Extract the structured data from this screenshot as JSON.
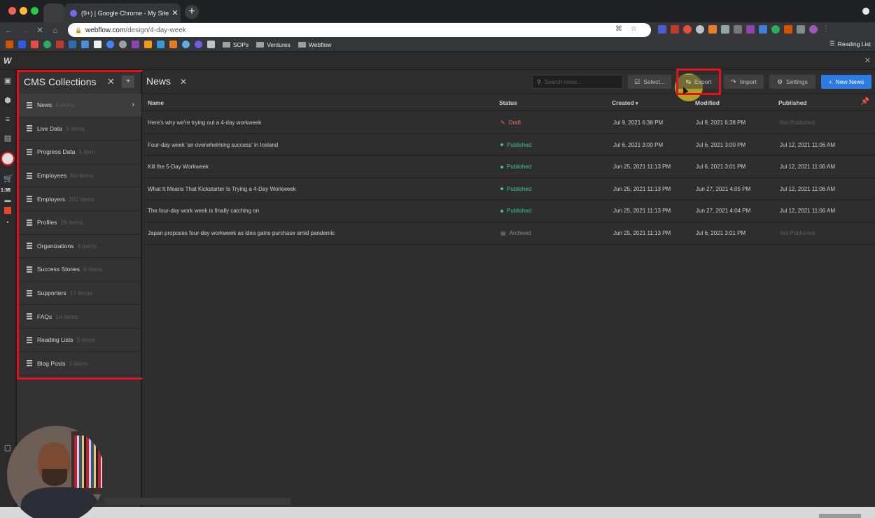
{
  "browser": {
    "tab_title": "(9+) | Google Chrome - My Site",
    "tab_close": "✕",
    "new_tab": "+",
    "url_host": "webflow.com",
    "url_path": "/design/4-day-week",
    "bookmark_folders": [
      "SOPs",
      "Ventures",
      "Webflow"
    ],
    "reading_list": "Reading List"
  },
  "webflow": {
    "logo": "W",
    "timer": "1:36"
  },
  "cms": {
    "title": "CMS Collections",
    "close": "✕",
    "add_icon": "+",
    "collections": [
      {
        "name": "News",
        "count": "6 items"
      },
      {
        "name": "Live Data",
        "count": "3 items"
      },
      {
        "name": "Progress Data",
        "count": "1 item"
      },
      {
        "name": "Employees",
        "count": "No items"
      },
      {
        "name": "Employers",
        "count": "201 items"
      },
      {
        "name": "Profiles",
        "count": "29 items"
      },
      {
        "name": "Organizations",
        "count": "6 items"
      },
      {
        "name": "Success Stories",
        "count": "6 items"
      },
      {
        "name": "Supporters",
        "count": "17 items"
      },
      {
        "name": "FAQs",
        "count": "14 items"
      },
      {
        "name": "Reading Lists",
        "count": "5 items"
      },
      {
        "name": "Blog Posts",
        "count": "2 items"
      }
    ]
  },
  "main": {
    "title": "News",
    "close": "✕",
    "search_placeholder": "Search news...",
    "buttons": {
      "select": "Select...",
      "export": "Export",
      "import": "Import",
      "settings": "Settings",
      "new": "New News"
    },
    "columns": {
      "name": "Name",
      "status": "Status",
      "created": "Created",
      "created_sort": "▾",
      "modified": "Modified",
      "published": "Published"
    },
    "rows": [
      {
        "name": "Here's why we're trying out a 4-day workweek",
        "status": "Draft",
        "created": "Jul 9, 2021 6:38 PM",
        "modified": "Jul 9, 2021 6:38 PM",
        "published": "Not Published"
      },
      {
        "name": "Four-day week 'an overwhelming success' in Iceland",
        "status": "Published",
        "created": "Jul 6, 2021 3:00 PM",
        "modified": "Jul 6, 2021 3:00 PM",
        "published": "Jul 12, 2021 11:06 AM"
      },
      {
        "name": "Kill the 5-Day Workweek",
        "status": "Published",
        "created": "Jun 25, 2021 11:13 PM",
        "modified": "Jul 6, 2021 3:01 PM",
        "published": "Jul 12, 2021 11:06 AM"
      },
      {
        "name": "What It Means That Kickstarter Is Trying a 4-Day Workweek",
        "status": "Published",
        "created": "Jun 25, 2021 11:13 PM",
        "modified": "Jun 27, 2021 4:05 PM",
        "published": "Jul 12, 2021 11:06 AM"
      },
      {
        "name": "The four-day work week is finally catching on",
        "status": "Published",
        "created": "Jun 25, 2021 11:13 PM",
        "modified": "Jun 27, 2021 4:04 PM",
        "published": "Jul 12, 2021 11:06 AM"
      },
      {
        "name": "Japan proposes four-day workweek as idea gains purchase amid pandemic",
        "status": "Archived",
        "created": "Jun 25, 2021 11:13 PM",
        "modified": "Jul 6, 2021 3:01 PM",
        "published": "Not Published"
      }
    ]
  },
  "colors": {
    "accent_blue": "#2d7be5",
    "draft": "#e8705a",
    "published": "#3fc68a",
    "archived": "#8a8a8a",
    "highlight_red": "#e4101b"
  }
}
